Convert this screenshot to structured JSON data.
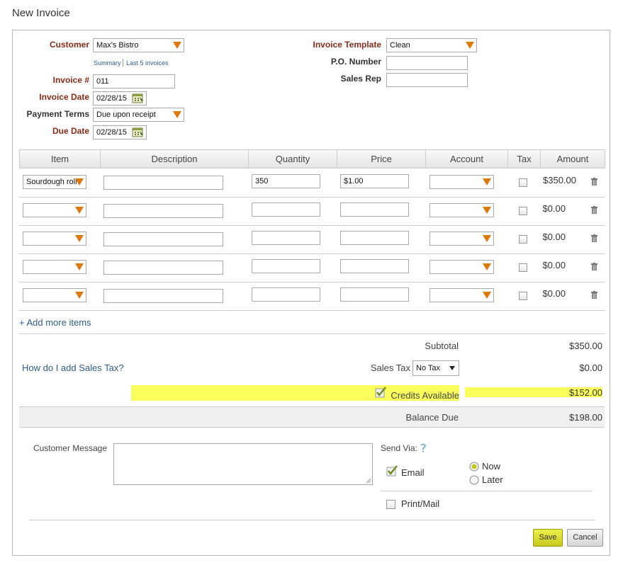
{
  "page": {
    "title": "New Invoice"
  },
  "header_left": {
    "customer_label": "Customer",
    "customer_value": "Max's Bistro",
    "summary_link": "Summary",
    "last5_link": "Last 5 invoices",
    "invoice_no_label": "Invoice #",
    "invoice_no_value": "011",
    "invoice_date_label": "Invoice Date",
    "invoice_date_value": "02/28/15",
    "payment_terms_label": "Payment Terms",
    "payment_terms_value": "Due upon receipt",
    "due_date_label": "Due Date",
    "due_date_value": "02/28/15"
  },
  "header_right": {
    "template_label": "Invoice Template",
    "template_value": "Clean",
    "po_label": "P.O. Number",
    "po_value": "",
    "sales_rep_label": "Sales Rep",
    "sales_rep_value": ""
  },
  "table": {
    "columns": [
      "Item",
      "Description",
      "Quantity",
      "Price",
      "Account",
      "Tax",
      "Amount"
    ],
    "rows": [
      {
        "item": "Sourdough roll",
        "description": "",
        "quantity": "350",
        "price": "$1.00",
        "account": "",
        "tax": false,
        "amount": "$350.00"
      },
      {
        "item": "",
        "description": "",
        "quantity": "",
        "price": "",
        "account": "",
        "tax": false,
        "amount": "$0.00"
      },
      {
        "item": "",
        "description": "",
        "quantity": "",
        "price": "",
        "account": "",
        "tax": false,
        "amount": "$0.00"
      },
      {
        "item": "",
        "description": "",
        "quantity": "",
        "price": "",
        "account": "",
        "tax": false,
        "amount": "$0.00"
      },
      {
        "item": "",
        "description": "",
        "quantity": "",
        "price": "",
        "account": "",
        "tax": false,
        "amount": "$0.00"
      }
    ],
    "add_more": "+ Add more items"
  },
  "totals": {
    "subtotal_label": "Subtotal",
    "subtotal_value": "$350.00",
    "sales_tax_help": "How do I add Sales Tax?",
    "sales_tax_label": "Sales Tax",
    "sales_tax_select": "No Tax",
    "sales_tax_value": "$0.00",
    "credits_label": "Credits Available",
    "credits_checked": true,
    "credits_value": "$152.00",
    "balance_label": "Balance Due",
    "balance_value": "$198.00"
  },
  "footer": {
    "customer_message_label": "Customer Message",
    "customer_message_value": "",
    "send_via_label": "Send Via:",
    "email_label": "Email",
    "email_checked": true,
    "now_label": "Now",
    "later_label": "Later",
    "timing_selected": "Now",
    "printmail_label": "Print/Mail",
    "printmail_checked": false,
    "save_label": "Save",
    "cancel_label": "Cancel"
  },
  "colors": {
    "required_label": "#8b2b17",
    "dropdown_arrow": "#e0790b",
    "link": "#2f5d8a",
    "highlight": "#fbff5c",
    "save_button": "#d6d832"
  }
}
